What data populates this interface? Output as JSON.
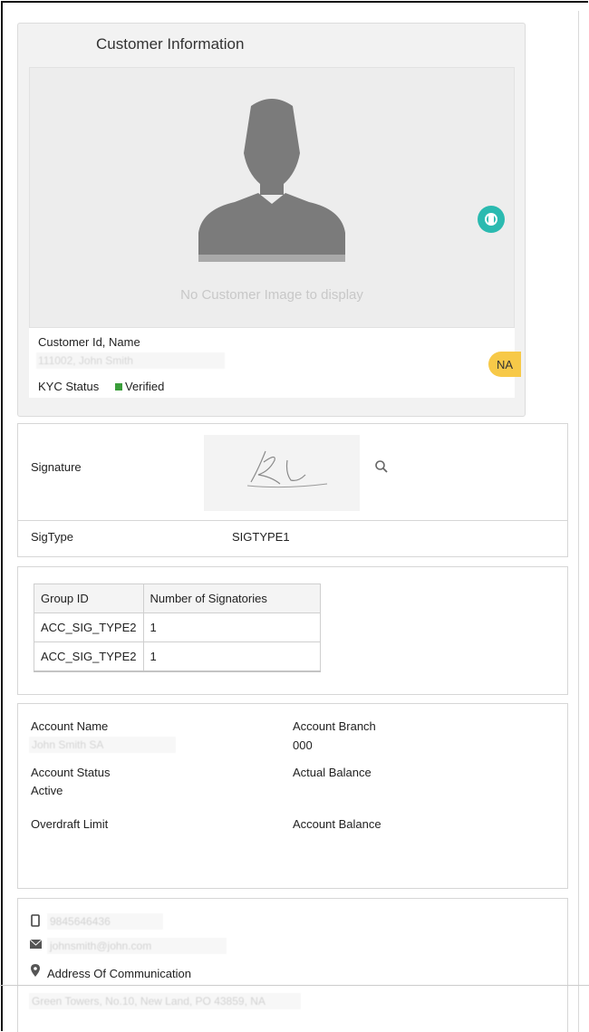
{
  "customer": {
    "title": "Customer Information",
    "no_image_text": "No Customer Image to display",
    "id_name_label": "Customer Id, Name",
    "id_name_value": "111002, John Smith",
    "na_badge": "NA",
    "kyc_label": "KYC Status",
    "kyc_status": "Verified"
  },
  "signature": {
    "label": "Signature",
    "sigtype_label": "SigType",
    "sigtype_value": "SIGTYPE1"
  },
  "groups": {
    "headers": [
      "Group ID",
      "Number of Signatories"
    ],
    "rows": [
      [
        "ACC_SIG_TYPE2",
        "1"
      ],
      [
        "ACC_SIG_TYPE2",
        "1"
      ]
    ]
  },
  "account": {
    "name_label": "Account Name",
    "name_value": "John Smith SA",
    "branch_label": "Account Branch",
    "branch_value": "000",
    "status_label": "Account Status",
    "status_value": "Active",
    "actual_balance_label": "Actual Balance",
    "overdraft_label": "Overdraft Limit",
    "account_balance_label": "Account Balance"
  },
  "contact": {
    "phone": "9845646436",
    "email": "johnsmith@john.com",
    "address_label": "Address Of Communication",
    "address_value": "Green Towers, No.10, New Land, PO 43859, NA"
  },
  "colors": {
    "badge": "#f7c948",
    "rotate_button": "#2bbab0",
    "kyc_verified": "#3a9d3a"
  },
  "icons": [
    "silhouette-icon",
    "rotate-icon",
    "check-icon",
    "search-icon",
    "mobile-icon",
    "mail-icon",
    "location-icon"
  ]
}
